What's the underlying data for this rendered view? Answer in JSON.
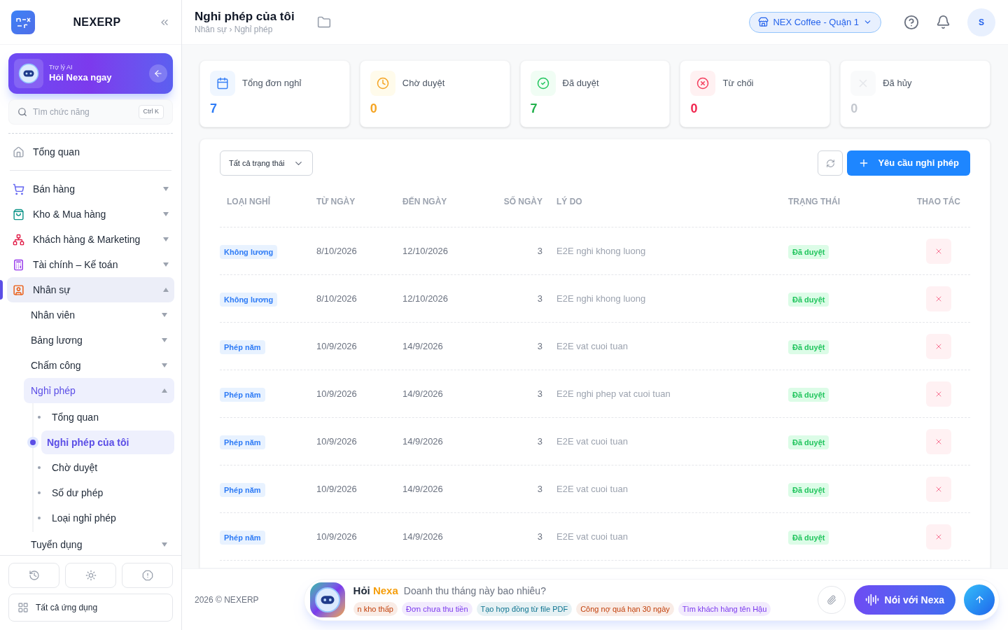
{
  "sidebar": {
    "brand": "NEXERP",
    "ai_card": {
      "label": "Trợ lý AI",
      "title": "Hỏi Nexa ngay"
    },
    "search": {
      "placeholder": "Tìm chức năng",
      "shortcut": "Ctrl K"
    },
    "home": {
      "label": "Tổng quan",
      "selected": false
    },
    "items": [
      {
        "label": "Bán hàng",
        "expanded": false,
        "selected": false
      },
      {
        "label": "Kho & Mua hàng",
        "expanded": false,
        "selected": false
      },
      {
        "label": "Khách hàng & Marketing",
        "expanded": false,
        "selected": false
      },
      {
        "label": "Tài chính – Kế toán",
        "expanded": false,
        "selected": false
      },
      {
        "label": "Nhân sự",
        "expanded": true,
        "selected": true,
        "children": [
          {
            "label": "Nhân viên",
            "expanded": false,
            "selected": false
          },
          {
            "label": "Bảng lương",
            "expanded": false,
            "selected": false
          },
          {
            "label": "Chấm công",
            "expanded": false,
            "selected": false
          },
          {
            "label": "Nghỉ phép",
            "expanded": true,
            "selected": true,
            "children": [
              {
                "label": "Tổng quan",
                "selected": false
              },
              {
                "label": "Nghỉ phép của tôi",
                "selected": true
              },
              {
                "label": "Chờ duyệt",
                "selected": false
              },
              {
                "label": "Số dư phép",
                "selected": false
              },
              {
                "label": "Loại nghỉ phép",
                "selected": false
              }
            ]
          },
          {
            "label": "Tuyển dụng",
            "expanded": false,
            "selected": false
          }
        ]
      }
    ],
    "all_apps": "Tất cả ứng dụng"
  },
  "header": {
    "title": "Nghỉ phép của tôi",
    "breadcrumb": "Nhân sự › Nghỉ phép",
    "branch": "NEX Coffee - Quận 1",
    "avatar": "S"
  },
  "stats": [
    {
      "kind": "total",
      "label": "Tổng đơn nghỉ",
      "value": "7"
    },
    {
      "kind": "pending",
      "label": "Chờ duyệt",
      "value": "0"
    },
    {
      "kind": "approved",
      "label": "Đã duyệt",
      "value": "7"
    },
    {
      "kind": "rejected",
      "label": "Từ chối",
      "value": "0"
    },
    {
      "kind": "cancelled",
      "label": "Đã hủy",
      "value": "0"
    }
  ],
  "toolbar": {
    "filter": "Tất cả trạng thái",
    "add_button": "Yêu cầu nghỉ phép"
  },
  "table": {
    "columns": [
      "LOẠI NGHỈ",
      "TỪ NGÀY",
      "ĐẾN NGÀY",
      "SỐ NGÀY",
      "LÝ DO",
      "TRẠNG THÁI",
      "THAO TÁC"
    ],
    "rows": [
      {
        "type": "Không lương",
        "from": "8/10/2026",
        "to": "12/10/2026",
        "days": "3",
        "reason": "E2E nghi khong luong",
        "status": "Đã duyệt"
      },
      {
        "type": "Không lương",
        "from": "8/10/2026",
        "to": "12/10/2026",
        "days": "3",
        "reason": "E2E nghi khong luong",
        "status": "Đã duyệt"
      },
      {
        "type": "Phép năm",
        "from": "10/9/2026",
        "to": "14/9/2026",
        "days": "3",
        "reason": "E2E vat cuoi tuan",
        "status": "Đã duyệt"
      },
      {
        "type": "Phép năm",
        "from": "10/9/2026",
        "to": "14/9/2026",
        "days": "3",
        "reason": "E2E nghi phep vat cuoi tuan",
        "status": "Đã duyệt"
      },
      {
        "type": "Phép năm",
        "from": "10/9/2026",
        "to": "14/9/2026",
        "days": "3",
        "reason": "E2E vat cuoi tuan",
        "status": "Đã duyệt"
      },
      {
        "type": "Phép năm",
        "from": "10/9/2026",
        "to": "14/9/2026",
        "days": "3",
        "reason": "E2E vat cuoi tuan",
        "status": "Đã duyệt"
      },
      {
        "type": "Phép năm",
        "from": "10/9/2026",
        "to": "14/9/2026",
        "days": "3",
        "reason": "E2E vat cuoi tuan",
        "status": "Đã duyệt"
      }
    ]
  },
  "footer": {
    "copyright": "2026 © NEXERP",
    "assistant": {
      "ask": "Hỏi",
      "name": "Nexa",
      "prompt": "Doanh thu tháng này bao nhiêu?",
      "voice_button": "Nói với Nexa",
      "chips": [
        {
          "text": "n kho thấp",
          "color": "#c2410c"
        },
        {
          "text": "Đơn chưa thu tiền",
          "color": "#7c3aed"
        },
        {
          "text": "Tạo hợp đồng từ file PDF",
          "color": "#0e7490"
        },
        {
          "text": "Công nợ quá hạn 30 ngày",
          "color": "#c2410c"
        },
        {
          "text": "Tìm khách hàng tên Hậu",
          "color": "#7c3aed"
        }
      ]
    }
  }
}
